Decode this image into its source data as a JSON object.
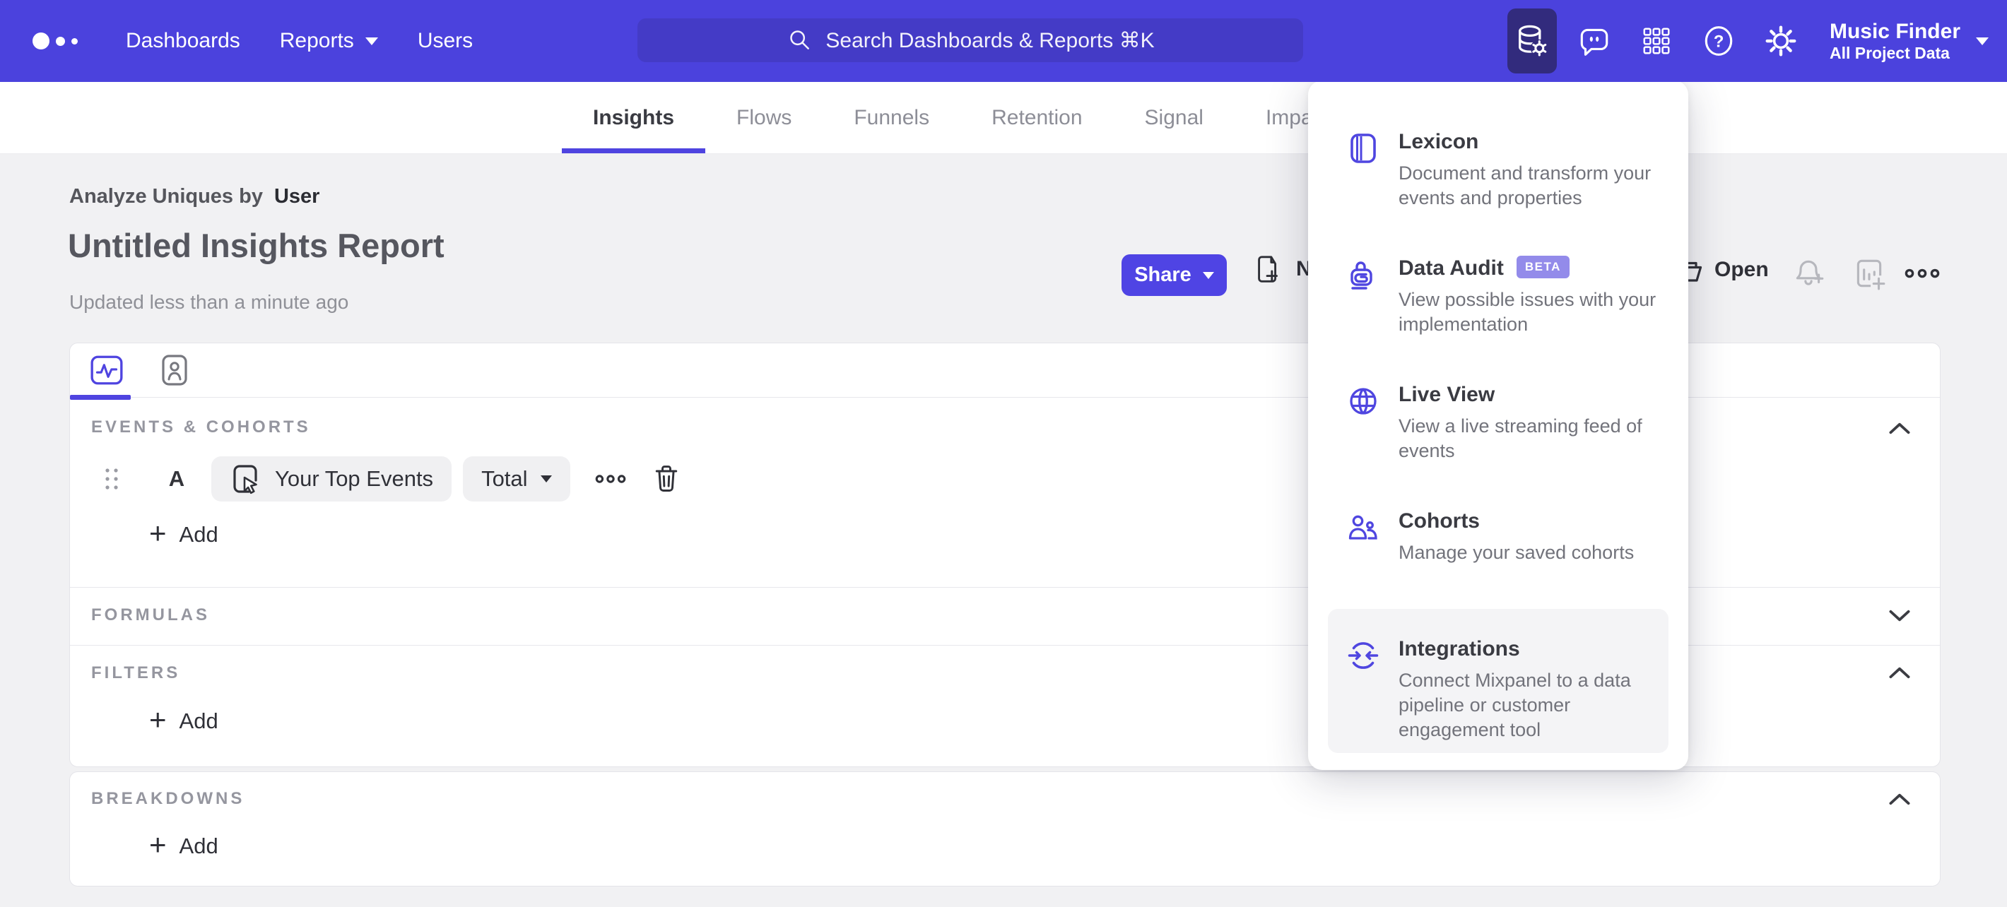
{
  "nav": {
    "items": [
      "Dashboards",
      "Reports",
      "Users"
    ],
    "search": {
      "placeholder": "Search Dashboards & Reports ⌘K"
    },
    "project_name": "Music Finder",
    "project_scope": "All Project Data"
  },
  "tabs": {
    "items": [
      {
        "label": "Insights",
        "active": true
      },
      {
        "label": "Flows"
      },
      {
        "label": "Funnels"
      },
      {
        "label": "Retention"
      },
      {
        "label": "Signal"
      },
      {
        "label": "Impact"
      }
    ]
  },
  "header": {
    "analyze_label": "Analyze Uniques by",
    "analyze_value": "User",
    "title": "Untitled Insights Report",
    "updated": "Updated less than a minute ago",
    "share": "Share",
    "new": "New",
    "open": "Open"
  },
  "builder": {
    "events_section": "EVENTS & COHORTS",
    "row": {
      "label": "A",
      "event": "Your Top Events",
      "aggregation": "Total"
    },
    "add": "Add",
    "formulas_section": "FORMULAS",
    "filters_section": "FILTERS",
    "breakdowns_section": "BREAKDOWNS"
  },
  "menu": {
    "items": [
      {
        "title": "Lexicon",
        "description": "Document and transform your events and properties"
      },
      {
        "title": "Data Audit",
        "badge": "BETA",
        "description": "View possible issues with your implementation"
      },
      {
        "title": "Live View",
        "description": "View a live streaming feed of events"
      },
      {
        "title": "Cohorts",
        "description": "Manage your saved cohorts"
      },
      {
        "title": "Integrations",
        "description": "Connect Mixpanel to a data pipeline or customer engagement tool",
        "highlighted": true
      }
    ]
  },
  "colors": {
    "nav_bg": "#4b42dd",
    "accent": "#4f44e0",
    "search_bg": "#443bc6",
    "active_tool_bg": "#322b7d",
    "beta_badge_bg": "#938bea",
    "page_bg": "#f1f1f3",
    "card_border": "#e4e4e9",
    "muted_text": "#8f9097",
    "dark_text": "#2f3037"
  }
}
